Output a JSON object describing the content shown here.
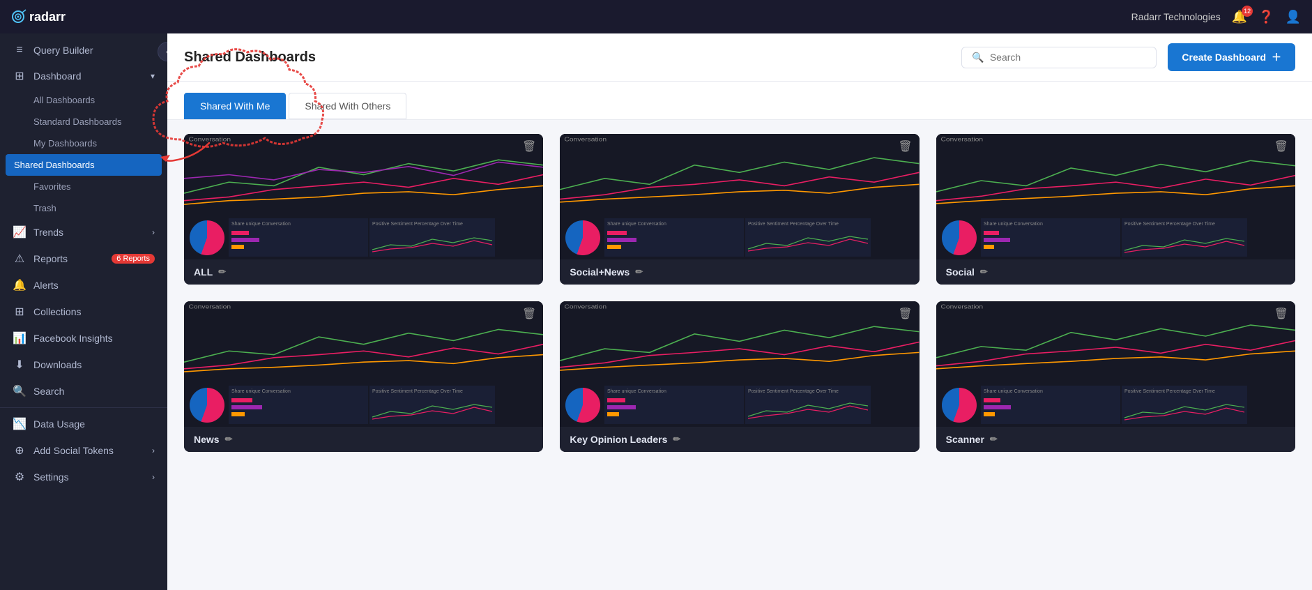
{
  "topbar": {
    "logo": "radarr",
    "org": "Radarr Technologies",
    "notification_count": "12",
    "help_label": "?"
  },
  "sidebar": {
    "toggle_icon": "chevron-left",
    "items": [
      {
        "id": "query-builder",
        "label": "Query Builder",
        "icon": "≡",
        "sub": []
      },
      {
        "id": "dashboard",
        "label": "Dashboard",
        "icon": "⊞",
        "expanded": true,
        "sub": [
          {
            "id": "all-dashboards",
            "label": "All Dashboards"
          },
          {
            "id": "standard-dashboards",
            "label": "Standard Dashboards"
          },
          {
            "id": "my-dashboards",
            "label": "My Dashboards"
          },
          {
            "id": "shared-dashboards",
            "label": "Shared Dashboards",
            "active": true
          },
          {
            "id": "favorites",
            "label": "Favorites"
          },
          {
            "id": "trash",
            "label": "Trash"
          }
        ]
      },
      {
        "id": "trends",
        "label": "Trends",
        "icon": "📈",
        "arrow": "›",
        "sub": []
      },
      {
        "id": "reports",
        "label": "Reports",
        "icon": "⚠",
        "badge": "6 Reports",
        "sub": []
      },
      {
        "id": "alerts",
        "label": "Alerts",
        "icon": "🔔",
        "sub": []
      },
      {
        "id": "collections",
        "label": "Collections",
        "icon": "⊞",
        "sub": []
      },
      {
        "id": "facebook-insights",
        "label": "Facebook Insights",
        "icon": "📊",
        "sub": []
      },
      {
        "id": "downloads",
        "label": "Downloads",
        "icon": "⬇",
        "sub": []
      },
      {
        "id": "search",
        "label": "Search",
        "icon": "🔍",
        "sub": []
      },
      {
        "id": "divider1",
        "type": "divider"
      },
      {
        "id": "data-usage",
        "label": "Data Usage",
        "icon": "📉",
        "sub": []
      },
      {
        "id": "add-social-tokens",
        "label": "Add Social Tokens",
        "icon": "⊕",
        "arrow": "›",
        "sub": []
      },
      {
        "id": "settings",
        "label": "Settings",
        "icon": "⚙",
        "arrow": "›",
        "sub": []
      }
    ]
  },
  "header": {
    "title": "Shared Dashboards",
    "search_placeholder": "Search",
    "create_button": "Create Dashboard"
  },
  "tabs": [
    {
      "id": "shared-with-me",
      "label": "Shared With Me",
      "active": true
    },
    {
      "id": "shared-with-others",
      "label": "Shared With Others",
      "active": false
    }
  ],
  "dashboards": [
    {
      "id": "all",
      "label": "ALL",
      "edit": true
    },
    {
      "id": "social-news",
      "label": "Social+News",
      "edit": true
    },
    {
      "id": "social",
      "label": "Social",
      "edit": true
    },
    {
      "id": "news",
      "label": "News",
      "edit": true
    },
    {
      "id": "key-opinion-leaders",
      "label": "Key Opinion Leaders",
      "edit": true
    },
    {
      "id": "scanner",
      "label": "Scanner",
      "edit": true
    }
  ],
  "annotation": {
    "visible": true
  }
}
